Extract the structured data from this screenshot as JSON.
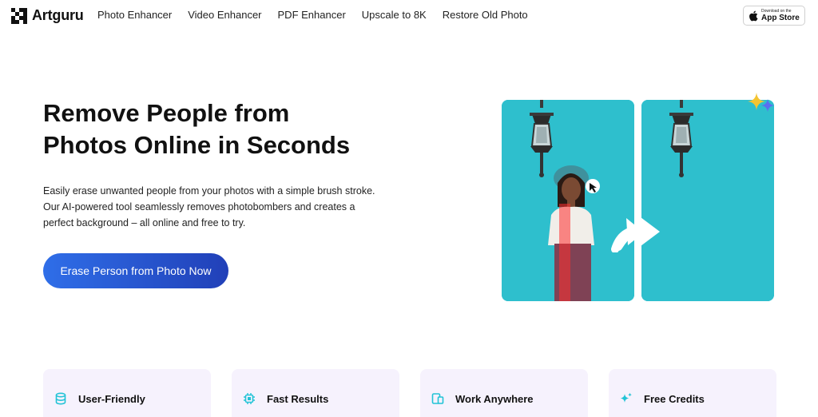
{
  "brand": {
    "name": "Artguru"
  },
  "nav": {
    "items": [
      {
        "label": "Photo Enhancer"
      },
      {
        "label": "Video Enhancer"
      },
      {
        "label": "PDF Enhancer"
      },
      {
        "label": "Upscale to 8K"
      },
      {
        "label": "Restore Old Photo"
      }
    ]
  },
  "app_store": {
    "small": "Download on the",
    "big": "App Store"
  },
  "hero": {
    "title_line1": "Remove People from",
    "title_line2": "Photos Online in Seconds",
    "desc_line1": "Easily erase unwanted people from your photos with a simple brush stroke.",
    "desc_line2": "Our AI-powered tool seamlessly removes photobombers and creates a",
    "desc_line3": "perfect background – all online and free to try.",
    "cta_label": "Erase Person from Photo Now"
  },
  "features": [
    {
      "label": "User-Friendly",
      "icon": "database-icon"
    },
    {
      "label": "Fast Results",
      "icon": "chip-icon"
    },
    {
      "label": "Work Anywhere",
      "icon": "devices-icon"
    },
    {
      "label": "Free Credits",
      "icon": "sparkles-icon"
    }
  ],
  "colors": {
    "accent_start": "#2f6ee8",
    "accent_end": "#2140b8",
    "panel_bg": "#2ebfcd",
    "card_bg": "#f6f2fd",
    "feature_icon": "#22c3d6"
  }
}
